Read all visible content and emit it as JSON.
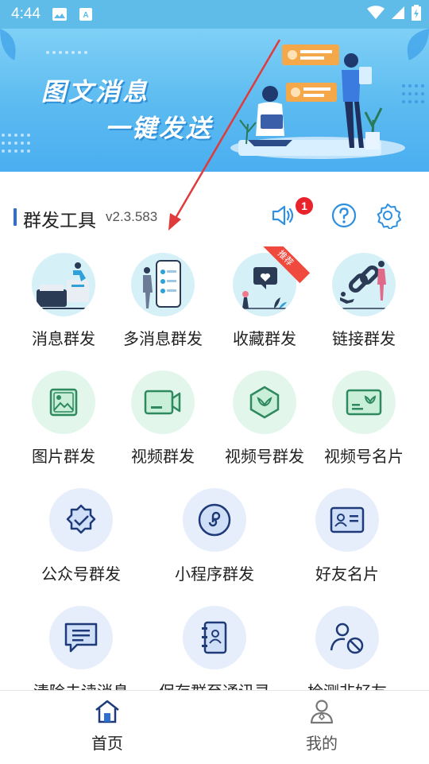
{
  "status_bar": {
    "time": "4:44"
  },
  "banner": {
    "line1": "图文消息",
    "line2": "一键发送"
  },
  "header": {
    "title": "群发工具",
    "version": "v2.3.583",
    "notification_count": "1"
  },
  "grid": [
    {
      "label": "消息群发",
      "icon": "message-broadcast-illustration"
    },
    {
      "label": "多消息群发",
      "icon": "multi-message-illustration"
    },
    {
      "label": "收藏群发",
      "icon": "favorites-illustration",
      "ribbon": "推荐"
    },
    {
      "label": "链接群发",
      "icon": "link-illustration"
    },
    {
      "label": "图片群发",
      "icon": "image-icon"
    },
    {
      "label": "视频群发",
      "icon": "video-camera-icon"
    },
    {
      "label": "视频号群发",
      "icon": "channels-icon"
    },
    {
      "label": "视频号名片",
      "icon": "channels-card-icon"
    },
    {
      "label": "公众号群发",
      "icon": "official-account-icon"
    },
    {
      "label": "小程序群发",
      "icon": "mini-program-icon"
    },
    {
      "label": "好友名片",
      "icon": "contact-card-icon"
    },
    {
      "label": "清除未读消息",
      "icon": "chat-message-icon"
    },
    {
      "label": "保存群至通讯录",
      "icon": "address-book-icon"
    },
    {
      "label": "检测非好友",
      "icon": "user-block-icon"
    }
  ],
  "bottom_nav": {
    "home": "首页",
    "mine": "我的"
  },
  "colors": {
    "status_bar": "#5fbbe8",
    "accent_blue": "#2f6fd0",
    "badge_red": "#e8232b",
    "icon_green": "#2e8a5e"
  }
}
